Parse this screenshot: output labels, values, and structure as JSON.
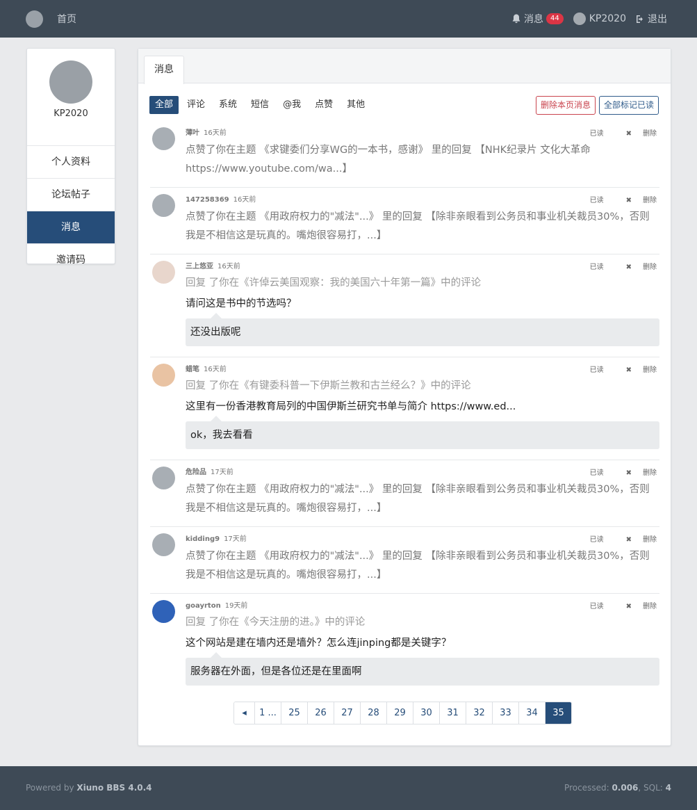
{
  "nav": {
    "home": "首页",
    "messages_label": "消息",
    "messages_count": "44",
    "username": "KP2020",
    "logout": "退出"
  },
  "sidebar": {
    "username": "KP2020",
    "items": [
      {
        "label": "个人资料"
      },
      {
        "label": "论坛帖子"
      },
      {
        "label": "消息"
      },
      {
        "label": "邀请码"
      }
    ]
  },
  "main": {
    "tab": "消息",
    "filters": [
      "全部",
      "评论",
      "系统",
      "短信",
      "@我",
      "点赞",
      "其他"
    ],
    "delete_page": "删除本页消息",
    "mark_all_read": "全部标记已读",
    "read_label": "已读",
    "delete_label": "删除",
    "messages": [
      {
        "user": "薄叶",
        "time": "16天前",
        "text": "点赞了你在主题 《求键委们分享WG的一本书，感谢》 里的回复 【NHK纪录片 文化大革命 https://www.youtube.com/wa...】"
      },
      {
        "user": "147258369",
        "time": "16天前",
        "text": "点赞了你在主题 《用政府权力的\"减法\"...》 里的回复 【除非亲眼看到公务员和事业机关裁员30%，否则我是不相信这是玩真的。嘴炮很容易打，...】"
      },
      {
        "user": "三上悠亚",
        "time": "16天前",
        "reply": "回复 了你在《许倬云美国观察：我的美国六十年第一篇》中的评论",
        "quote": "请问这是书中的节选吗？",
        "answer": "还没出版呢"
      },
      {
        "user": "蜡笔",
        "time": "16天前",
        "reply": "回复 了你在《有键委科普一下伊斯兰教和古兰经么？》中的评论",
        "quote": "这里有一份香港教育局列的中国伊斯兰研究书单与简介 https://www.ed...",
        "answer": "ok，我去看看"
      },
      {
        "user": "危险品",
        "time": "17天前",
        "text": "点赞了你在主题 《用政府权力的\"减法\"...》 里的回复 【除非亲眼看到公务员和事业机关裁员30%，否则我是不相信这是玩真的。嘴炮很容易打，...】"
      },
      {
        "user": "kidding9",
        "time": "17天前",
        "text": "点赞了你在主题 《用政府权力的\"减法\"...》 里的回复 【除非亲眼看到公务员和事业机关裁员30%，否则我是不相信这是玩真的。嘴炮很容易打，...】"
      },
      {
        "user": "goayrton",
        "time": "19天前",
        "reply": "回复 了你在《今天注册的进。》中的评论",
        "quote": "这个网站是建在墙内还是墙外？怎么连jinping都是关键字？",
        "answer": "服务器在外面，但是各位还是在里面啊"
      }
    ],
    "pages": [
      "◂",
      "1 ...",
      "25",
      "26",
      "27",
      "28",
      "29",
      "30",
      "31",
      "32",
      "33",
      "34",
      "35"
    ],
    "current_page": "35"
  },
  "footer": {
    "powered_prefix": "Powered by ",
    "powered_name": "Xiuno BBS 4.0.4",
    "processed_prefix": "Processed: ",
    "processed_value": "0.006",
    "sql_prefix": ", SQL: ",
    "sql_value": "4"
  }
}
